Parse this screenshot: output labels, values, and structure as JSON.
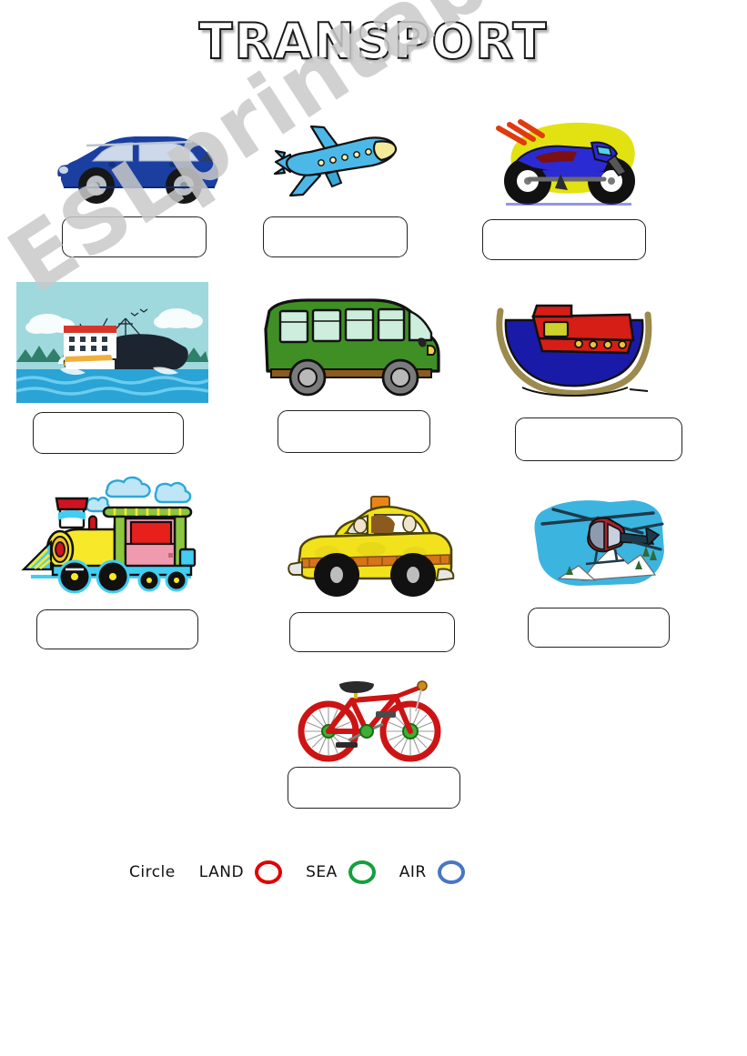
{
  "page": {
    "title": "TRANSPORT",
    "watermark": "ESLprintables.com",
    "background_color": "#ffffff"
  },
  "footer": {
    "instruction": "Circle",
    "categories": [
      {
        "label": "LAND",
        "ring_color": "#e00000",
        "icon": "circle-outline-red"
      },
      {
        "label": "SEA",
        "ring_color": "#13a03c",
        "icon": "circle-outline-green"
      },
      {
        "label": "AIR",
        "ring_color": "#4876c4",
        "icon": "circle-outline-blue"
      }
    ]
  },
  "items": [
    {
      "id": 1,
      "name": "car",
      "icon": "car-icon",
      "answer": "",
      "placeholder": ""
    },
    {
      "id": 2,
      "name": "plane",
      "icon": "plane-icon",
      "answer": "",
      "placeholder": ""
    },
    {
      "id": 3,
      "name": "motorbike",
      "icon": "motorbike-icon",
      "answer": "",
      "placeholder": ""
    },
    {
      "id": 4,
      "name": "ship",
      "icon": "ship-icon",
      "answer": "",
      "placeholder": ""
    },
    {
      "id": 5,
      "name": "bus",
      "icon": "bus-icon",
      "answer": "",
      "placeholder": ""
    },
    {
      "id": 6,
      "name": "boat",
      "icon": "boat-icon",
      "answer": "",
      "placeholder": ""
    },
    {
      "id": 7,
      "name": "train",
      "icon": "train-icon",
      "answer": "",
      "placeholder": ""
    },
    {
      "id": 8,
      "name": "taxi",
      "icon": "taxi-icon",
      "answer": "",
      "placeholder": ""
    },
    {
      "id": 9,
      "name": "helicopter",
      "icon": "helicopter-icon",
      "answer": "",
      "placeholder": ""
    },
    {
      "id": 10,
      "name": "bicycle",
      "icon": "bicycle-icon",
      "answer": "",
      "placeholder": ""
    }
  ],
  "colors": {
    "car_body": "#1b3fa0",
    "plane_body": "#4cb8e8",
    "plane_nose": "#f2ec9a",
    "motorbike_body": "#2b2bd4",
    "motorbike_burst": "#e2e213",
    "motorbike_streak": "#e03a10",
    "ship_sky": "#9fd9dd",
    "ship_water": "#2aa3d6",
    "ship_hull": "#1c2430",
    "ship_red": "#d8352a",
    "bus_body": "#3f8f25",
    "bus_window": "#cdeedd",
    "bus_chassis": "#8a5a1e",
    "boat_hull": "#1a1aa8",
    "boat_cabin": "#d61d16",
    "boat_rim": "#9c8a4e",
    "train_body": "#42cdf2",
    "train_yellow": "#f7e82a",
    "train_red": "#e8201c",
    "train_pink": "#f09ab0",
    "train_green": "#8cc63f",
    "taxi_body": "#f2e21c",
    "taxi_sign": "#e8851a",
    "taxi_stripe": "#d6741a",
    "heli_body": "#a8242c",
    "heli_sky": "#3cb4e0",
    "bike_frame": "#cc1414",
    "bike_hub": "#3fae36",
    "outline": "#111111"
  }
}
